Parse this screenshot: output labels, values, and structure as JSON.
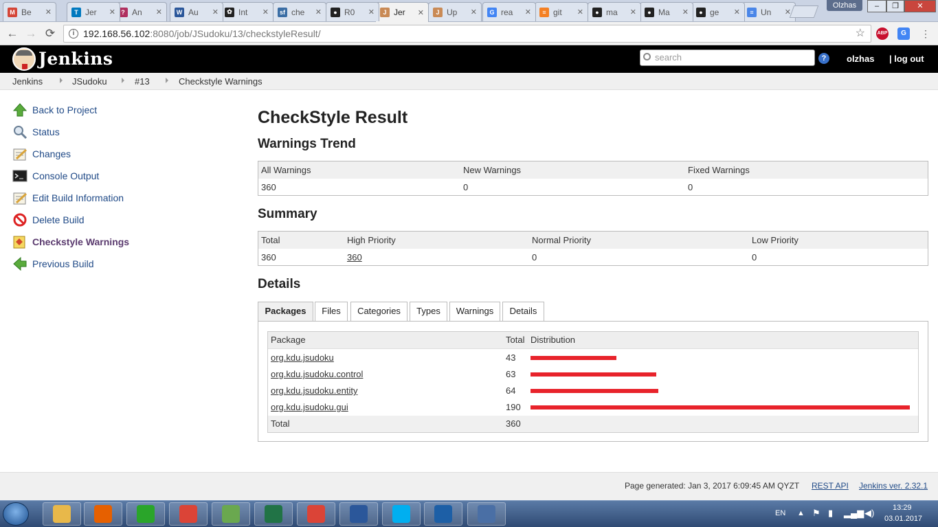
{
  "browser": {
    "tabs": [
      {
        "title": "Be",
        "icon": "gmail-icon",
        "color": "#d44638",
        "glyph": "M"
      },
      {
        "title": "Jer",
        "icon": "trello-icon",
        "color": "#0079bf",
        "glyph": "T"
      },
      {
        "title": "An",
        "icon": "question-icon",
        "color": "#b03060",
        "glyph": "?"
      },
      {
        "title": "Au",
        "icon": "word-icon",
        "color": "#2b579a",
        "glyph": "W"
      },
      {
        "title": "Int",
        "icon": "paw-icon",
        "color": "#222222",
        "glyph": "✿"
      },
      {
        "title": "che",
        "icon": "sourceforge-icon",
        "color": "#3b6ea5",
        "glyph": "sf"
      },
      {
        "title": "R0",
        "icon": "github-icon",
        "color": "#222222",
        "glyph": "●"
      },
      {
        "title": "Jer",
        "icon": "jenkins-icon",
        "color": "#c98a55",
        "glyph": "J",
        "active": true
      },
      {
        "title": "Up",
        "icon": "jenkins-icon",
        "color": "#c98a55",
        "glyph": "J"
      },
      {
        "title": "rea",
        "icon": "google-icon",
        "color": "#4285f4",
        "glyph": "G"
      },
      {
        "title": "git",
        "icon": "stackoverflow-icon",
        "color": "#f48024",
        "glyph": "≡"
      },
      {
        "title": "ma",
        "icon": "github-icon",
        "color": "#222222",
        "glyph": "●"
      },
      {
        "title": "Ma",
        "icon": "github-icon",
        "color": "#222222",
        "glyph": "●"
      },
      {
        "title": "ge",
        "icon": "github-icon",
        "color": "#222222",
        "glyph": "●"
      },
      {
        "title": "Un",
        "icon": "docs-icon",
        "color": "#4a86e8",
        "glyph": "≡"
      }
    ],
    "profile_name": "Olzhas",
    "url_host": "192.168.56.102",
    "url_path": ":8080/job/JSudoku/13/checkstyleResult/",
    "ext_abp": "ABP"
  },
  "jenkins": {
    "brand": "Jenkins",
    "search_placeholder": "search",
    "help": "?",
    "username": "olzhas",
    "logout": "| log out"
  },
  "breadcrumb": [
    "Jenkins",
    "JSudoku",
    "#13",
    "Checkstyle Warnings"
  ],
  "sidebar": [
    {
      "label": "Back to Project",
      "icon": "up-arrow-icon"
    },
    {
      "label": "Status",
      "icon": "magnifier-icon"
    },
    {
      "label": "Changes",
      "icon": "notepad-icon"
    },
    {
      "label": "Console Output",
      "icon": "terminal-icon"
    },
    {
      "label": "Edit Build Information",
      "icon": "notepad-icon"
    },
    {
      "label": "Delete Build",
      "icon": "no-entry-icon"
    },
    {
      "label": "Checkstyle Warnings",
      "icon": "checkstyle-icon",
      "current": true
    },
    {
      "label": "Previous Build",
      "icon": "left-arrow-icon"
    }
  ],
  "main": {
    "title": "CheckStyle Result",
    "trend_heading": "Warnings Trend",
    "trend": {
      "headers": [
        "All Warnings",
        "New Warnings",
        "Fixed Warnings"
      ],
      "values": [
        "360",
        "0",
        "0"
      ]
    },
    "summary_heading": "Summary",
    "summary": {
      "headers": [
        "Total",
        "High Priority",
        "Normal Priority",
        "Low Priority"
      ],
      "values": [
        "360",
        "360",
        "0",
        "0"
      ]
    },
    "details_heading": "Details",
    "detail_tabs": [
      "Packages",
      "Files",
      "Categories",
      "Types",
      "Warnings",
      "Details"
    ],
    "packages": {
      "headers": [
        "Package",
        "Total",
        "Distribution"
      ],
      "rows": [
        {
          "name": "org.kdu.jsudoku",
          "total": 43
        },
        {
          "name": "org.kdu.jsudoku.control",
          "total": 63
        },
        {
          "name": "org.kdu.jsudoku.entity",
          "total": 64
        },
        {
          "name": "org.kdu.jsudoku.gui",
          "total": 190
        }
      ],
      "total_label": "Total",
      "total_value": "360",
      "bar_color": "#e8232b"
    }
  },
  "footer": {
    "generated": "Page generated: Jan 3, 2017 6:09:45 AM QYZT",
    "rest_api": "REST API",
    "version": "Jenkins ver. 2.32.1"
  },
  "taskbar": {
    "apps": [
      {
        "icon": "explorer-icon",
        "color": "#e8b84a"
      },
      {
        "icon": "firefox-icon",
        "color": "#e66000"
      },
      {
        "icon": "mail-agent-icon",
        "color": "#2aa52a"
      },
      {
        "icon": "chrome-icon",
        "color": "#db4437"
      },
      {
        "icon": "notepadpp-icon",
        "color": "#6aa84f"
      },
      {
        "icon": "excel-icon",
        "color": "#217346"
      },
      {
        "icon": "chrome-icon",
        "color": "#db4437"
      },
      {
        "icon": "word-icon",
        "color": "#2b579a"
      },
      {
        "icon": "skype-icon",
        "color": "#00aff0"
      },
      {
        "icon": "virtualbox-icon",
        "color": "#1d5fa6"
      },
      {
        "icon": "network-tool-icon",
        "color": "#4a6fa5"
      }
    ],
    "lang": "EN",
    "time": "13:29",
    "date": "03.01.2017"
  }
}
